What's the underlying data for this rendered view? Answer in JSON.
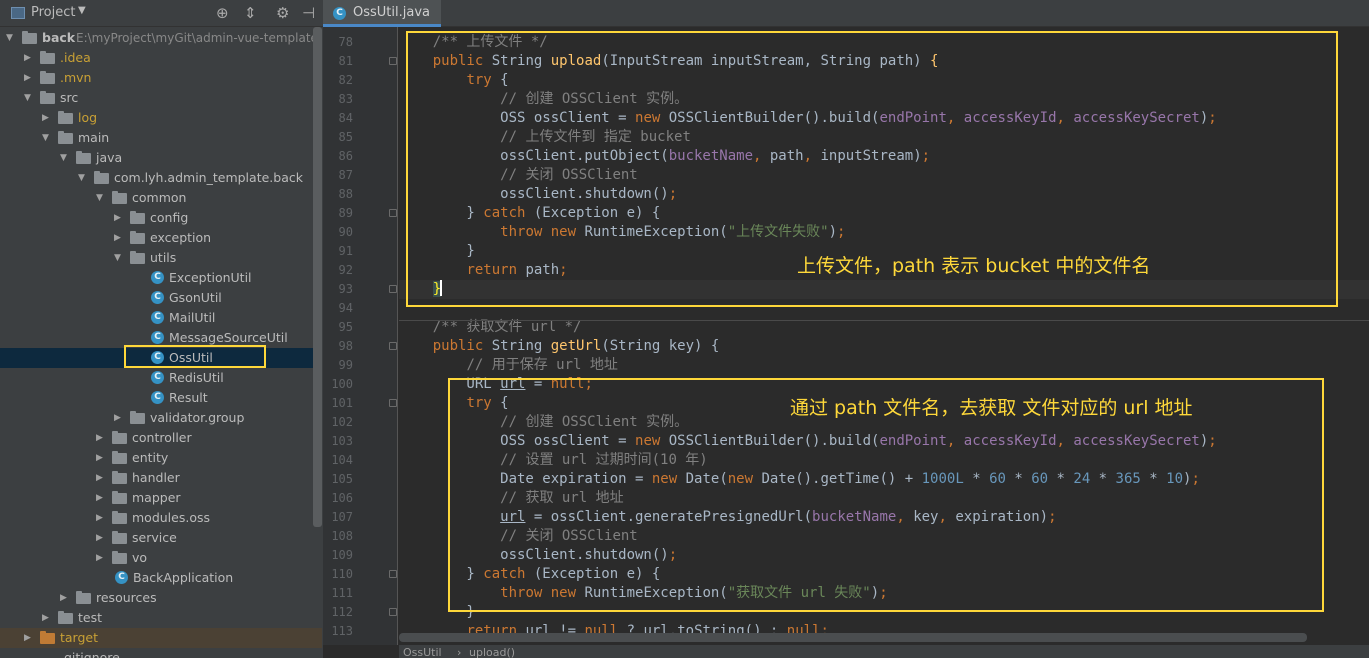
{
  "project_panel": {
    "title": "Project",
    "tools": [
      "target-icon",
      "collapse-icon",
      "gear-icon",
      "hide-icon"
    ],
    "tree": [
      {
        "label": "back",
        "path": "E:\\myProject\\myGit\\admin-vue-template\\b",
        "depth": 0,
        "type": "folder",
        "expanded": true
      },
      {
        "label": ".idea",
        "depth": 1,
        "type": "folder",
        "excluded": true
      },
      {
        "label": ".mvn",
        "depth": 1,
        "type": "folder",
        "excluded": true
      },
      {
        "label": "src",
        "depth": 1,
        "type": "folder",
        "expanded": true
      },
      {
        "label": "log",
        "depth": 2,
        "type": "folder",
        "excluded": true
      },
      {
        "label": "main",
        "depth": 2,
        "type": "folder",
        "expanded": true
      },
      {
        "label": "java",
        "depth": 3,
        "type": "folder",
        "expanded": true
      },
      {
        "label": "com.lyh.admin_template.back",
        "depth": 4,
        "type": "folder",
        "expanded": true
      },
      {
        "label": "common",
        "depth": 5,
        "type": "folder",
        "expanded": true
      },
      {
        "label": "config",
        "depth": 6,
        "type": "folder"
      },
      {
        "label": "exception",
        "depth": 6,
        "type": "folder"
      },
      {
        "label": "utils",
        "depth": 6,
        "type": "folder",
        "expanded": true
      },
      {
        "label": "ExceptionUtil",
        "depth": 7,
        "type": "class"
      },
      {
        "label": "GsonUtil",
        "depth": 7,
        "type": "class"
      },
      {
        "label": "MailUtil",
        "depth": 7,
        "type": "class"
      },
      {
        "label": "MessageSourceUtil",
        "depth": 7,
        "type": "class"
      },
      {
        "label": "OssUtil",
        "depth": 7,
        "type": "class",
        "selected": true
      },
      {
        "label": "RedisUtil",
        "depth": 7,
        "type": "class"
      },
      {
        "label": "Result",
        "depth": 7,
        "type": "class"
      },
      {
        "label": "validator.group",
        "depth": 6,
        "type": "folder"
      },
      {
        "label": "controller",
        "depth": 5,
        "type": "folder"
      },
      {
        "label": "entity",
        "depth": 5,
        "type": "folder"
      },
      {
        "label": "handler",
        "depth": 5,
        "type": "folder"
      },
      {
        "label": "mapper",
        "depth": 5,
        "type": "folder"
      },
      {
        "label": "modules.oss",
        "depth": 5,
        "type": "folder"
      },
      {
        "label": "service",
        "depth": 5,
        "type": "folder"
      },
      {
        "label": "vo",
        "depth": 5,
        "type": "folder"
      },
      {
        "label": "BackApplication",
        "depth": 5,
        "type": "class"
      },
      {
        "label": "resources",
        "depth": 3,
        "type": "folder"
      },
      {
        "label": "test",
        "depth": 2,
        "type": "folder"
      },
      {
        "label": "target",
        "depth": 1,
        "type": "folder",
        "excluded": true,
        "orange": true
      },
      {
        "label": ".gitignore",
        "depth": 1,
        "type": "file"
      }
    ]
  },
  "editor": {
    "tab": "OssUtil.java",
    "lines": [
      {
        "n": "78",
        "html": "    <span class='cm'>/** 上传文件 */</span>"
      },
      {
        "n": "81",
        "html": "    <span class='kw'>public</span> String <span class='fn'>upload</span>(InputStream inputStream, String path) <span class='fn'>{</span>"
      },
      {
        "n": "82",
        "html": "        <span class='kw'>try</span> {"
      },
      {
        "n": "83",
        "html": "            <span class='cm'>// 创建 OSSClient 实例。</span>"
      },
      {
        "n": "84",
        "html": "            OSS ossClient = <span class='kw'>new</span> OSSClientBuilder().build(<span class='fld'>endPoint</span><span class='kw'>,</span> <span class='fld'>accessKeyId</span><span class='kw'>,</span> <span class='fld'>accessKeySecret</span>)<span class='kw'>;</span>"
      },
      {
        "n": "85",
        "html": "            <span class='cm'>// 上传文件到 指定 bucket</span>"
      },
      {
        "n": "86",
        "html": "            ossClient.putObject(<span class='fld'>bucketName</span><span class='kw'>,</span> path<span class='kw'>,</span> inputStream)<span class='kw'>;</span>"
      },
      {
        "n": "87",
        "html": "            <span class='cm'>// 关闭 OSSClient</span>"
      },
      {
        "n": "88",
        "html": "            ossClient.shutdown()<span class='kw'>;</span>"
      },
      {
        "n": "89",
        "html": "        } <span class='kw'>catch</span> (Exception e) {"
      },
      {
        "n": "90",
        "html": "            <span class='kw'>throw new</span> RuntimeException(<span class='str'>\"上传文件失败\"</span>)<span class='kw'>;</span>"
      },
      {
        "n": "91",
        "html": "        }"
      },
      {
        "n": "92",
        "html": "        <span class='kw'>return</span> path<span class='kw'>;</span>"
      },
      {
        "n": "93",
        "html": "    <span class='brace'>}</span><span class='caret-bar'></span>",
        "current": true
      },
      {
        "n": "94",
        "html": ""
      },
      {
        "n": "95",
        "html": "    <span class='cm'>/** 获取文件 url */</span>"
      },
      {
        "n": "98",
        "html": "    <span class='kw'>public</span> String <span class='fn'>getUrl</span>(String key) {"
      },
      {
        "n": "99",
        "html": "        <span class='cm'>// 用于保存 url 地址</span>"
      },
      {
        "n": "100",
        "html": "        URL <span class='und'>url</span> = <span class='kw'>null;</span>"
      },
      {
        "n": "101",
        "html": "        <span class='kw'>try</span> {"
      },
      {
        "n": "102",
        "html": "            <span class='cm'>// 创建 OSSClient 实例。</span>"
      },
      {
        "n": "103",
        "html": "            OSS ossClient = <span class='kw'>new</span> OSSClientBuilder().build(<span class='fld'>endPoint</span><span class='kw'>,</span> <span class='fld'>accessKeyId</span><span class='kw'>,</span> <span class='fld'>accessKeySecret</span>)<span class='kw'>;</span>"
      },
      {
        "n": "104",
        "html": "            <span class='cm'>// 设置 url 过期时间(10 年)</span>"
      },
      {
        "n": "105",
        "html": "            Date expiration = <span class='kw'>new</span> Date(<span class='kw'>new</span> Date().getTime() + <span class='num'>1000L</span> * <span class='num'>60</span> * <span class='num'>60</span> * <span class='num'>24</span> * <span class='num'>365</span> * <span class='num'>10</span>)<span class='kw'>;</span>"
      },
      {
        "n": "106",
        "html": "            <span class='cm'>// 获取 url 地址</span>"
      },
      {
        "n": "107",
        "html": "            <span class='und'>url</span> = ossClient.generatePresignedUrl(<span class='fld'>bucketName</span><span class='kw'>,</span> key<span class='kw'>,</span> expiration)<span class='kw'>;</span>"
      },
      {
        "n": "108",
        "html": "            <span class='cm'>// 关闭 OSSClient</span>"
      },
      {
        "n": "109",
        "html": "            ossClient.shutdown()<span class='kw'>;</span>"
      },
      {
        "n": "110",
        "html": "        } <span class='kw'>catch</span> (Exception e) {"
      },
      {
        "n": "111",
        "html": "            <span class='kw'>throw new</span> RuntimeException(<span class='str'>\"获取文件 url 失败\"</span>)<span class='kw'>;</span>"
      },
      {
        "n": "112",
        "html": "        }"
      },
      {
        "n": "113",
        "html": "        <span class='kw'>return</span> <span class='und'>url</span> != <span class='kw'>null</span> ? <span class='und'>url</span>.toString() : <span class='kw'>null;</span>"
      }
    ],
    "annotations": {
      "upload_note": "上传文件，path 表示 bucket 中的文件名",
      "geturl_note": "通过 path 文件名，去获取 文件对应的 url 地址"
    },
    "breadcrumb": [
      "OssUtil",
      "upload()"
    ]
  },
  "colors": {
    "highlight_box": "#fed83a",
    "selection": "#0d293e",
    "keyword": "#cc7832",
    "comment": "#808080"
  }
}
